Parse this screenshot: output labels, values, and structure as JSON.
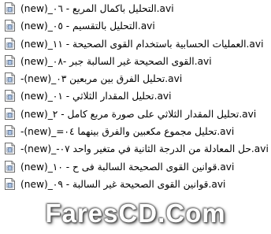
{
  "files": [
    {
      "name": "(new)_التحليل باكمال المربع - ٠٦.avi"
    },
    {
      "name": "(new)_التحليل بالتقسيم - ٠٥.avi"
    },
    {
      "name": "(new)_العمليات الحسابية باستخدام القوى الصحيحة - ١١.avi"
    },
    {
      "name": "(new)_القوى الصحيحة غير السالبة جبر -٠٨.avi"
    },
    {
      "name": "-(new)_تحليل الفرق بين مربعين ٠٣.avi"
    },
    {
      "name": "(new)_تحليل المقدار الثلاثي - ٠١.avi"
    },
    {
      "name": "(new)_تحليل المقدار الثلاثي على صورة مربع كامل - ٢.avi"
    },
    {
      "name": "-(new)_=تحليل مجموع مكعبين والفرق بينهما ٠٤.avi"
    },
    {
      "name": "-(new)_-حل المعادلة من الدرجة الثانية في متغير واحد ٠٧.avi"
    },
    {
      "name": "(new)_قوانين القوى الصحيحة السالبة فى ح - ١٠.avi"
    },
    {
      "name": "(new)_قوانين القوى الصحيحة غير السالبة - ٠٩.avi"
    }
  ],
  "file_icon": "video-file-icon",
  "watermark": "FaresCD.Com"
}
